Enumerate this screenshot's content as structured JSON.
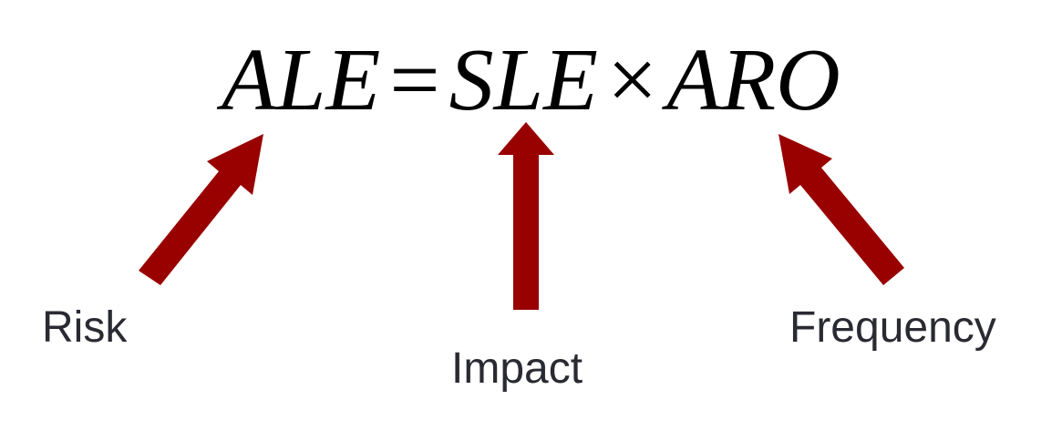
{
  "formula": {
    "lhs": "ALE",
    "equals": "=",
    "term1": "SLE",
    "times": "×",
    "term2": "ARO"
  },
  "labels": {
    "risk": "Risk",
    "impact": "Impact",
    "frequency": "Frequency"
  },
  "colors": {
    "arrow": "#990000",
    "label_text": "#2a2a33",
    "formula_text": "#000000"
  }
}
